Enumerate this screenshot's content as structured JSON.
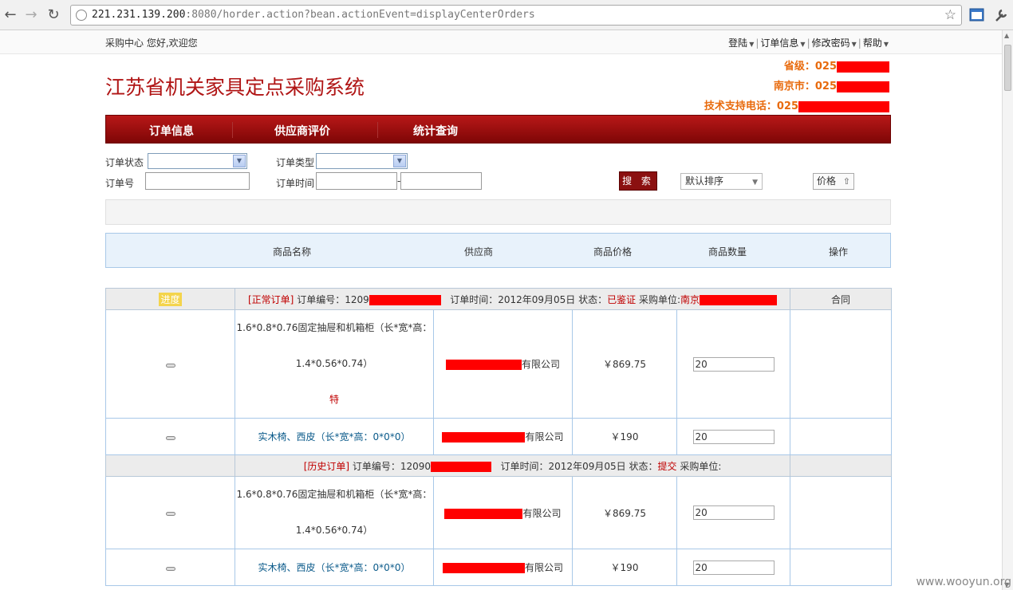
{
  "browser": {
    "url_host": "221.231.139.200",
    "url_rest": ":8080/horder.action?bean.actionEvent=displayCenterOrders"
  },
  "topbar": {
    "welcome": "采购中心 您好,欢迎您",
    "nav": [
      "登陆",
      "订单信息",
      "修改密码",
      "帮助"
    ]
  },
  "header": {
    "site_title": "江苏省机关家具定点采购系统",
    "contact_province": "省级：025",
    "contact_city": "南京市：025",
    "contact_support": "技术支持电话：025"
  },
  "menu": [
    "订单信息",
    "供应商评价",
    "统计查询"
  ],
  "filters": {
    "status_label": "订单状态",
    "type_label": "订单类型",
    "order_no_label": "订单号",
    "time_label": "订单时间",
    "time_sep": "-",
    "search_label": "搜 索",
    "sort_value": "默认排序",
    "price_sort_label": "价格"
  },
  "table_headers": [
    "商品名称",
    "供应商",
    "商品价格",
    "商品数量",
    "操作"
  ],
  "orders": [
    {
      "progress_label": "进度",
      "type_tag": "[正常订单]",
      "order_no_prefix": "订单编号：1209",
      "order_time": "订单时间：2012年09月05日",
      "status_label": "状态：",
      "status_value": "已鉴证",
      "unit_label": "采购单位:",
      "unit_value": "南京",
      "contract_label": "合同",
      "items": [
        {
          "name_line1": "1.6*0.8*0.76固定抽屉和机箱柜（长*宽*高：",
          "name_line2": "1.4*0.56*0.74）",
          "special": "特",
          "supplier_suffix": "有限公司",
          "price": "￥869.75",
          "qty": "20"
        },
        {
          "name_line1": "实木椅、西皮（长*宽*高：0*0*0）",
          "name_line2": "",
          "special": "",
          "supplier_suffix": "有限公司",
          "price": "￥190",
          "qty": "20"
        }
      ]
    },
    {
      "progress_label": "",
      "type_tag": "[历史订单]",
      "order_no_prefix": "订单编号：12090",
      "order_time": "订单时间：2012年09月05日",
      "status_label": "状态：",
      "status_value": "提交",
      "unit_label": "采购单位:",
      "unit_value": "",
      "contract_label": "",
      "items": [
        {
          "name_line1": "1.6*0.8*0.76固定抽屉和机箱柜（长*宽*高：",
          "name_line2": "1.4*0.56*0.74）",
          "special": "",
          "supplier_suffix": "有限公司",
          "price": "￥869.75",
          "qty": "20"
        },
        {
          "name_line1": "实木椅、西皮（长*宽*高：0*0*0）",
          "name_line2": "",
          "special": "",
          "supplier_suffix": "有限公司",
          "price": "￥190",
          "qty": "20"
        }
      ]
    }
  ],
  "watermark": "www.wooyun.org",
  "colors": {
    "brand_red": "#b01515",
    "contact_orange": "#e86a0c",
    "redaction": "#ff0000"
  }
}
